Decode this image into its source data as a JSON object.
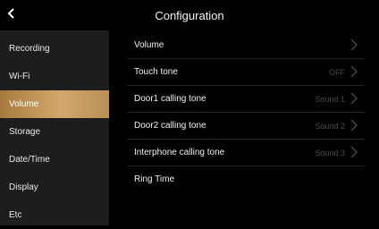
{
  "header": {
    "title": "Configuration",
    "back_icon": "chevron-left-icon"
  },
  "sidebar": {
    "items": [
      {
        "label": "Recording"
      },
      {
        "label": "Wi-Fi"
      },
      {
        "label": "Volume",
        "active": true
      },
      {
        "label": "Storage"
      },
      {
        "label": "Date/Time"
      },
      {
        "label": "Display"
      },
      {
        "label": "Etc"
      }
    ],
    "active_color": "#c89d5f"
  },
  "content": {
    "rows": [
      {
        "label": "Volume",
        "value": ""
      },
      {
        "label": "Touch tone",
        "value": "OFF"
      },
      {
        "label": "Door1 calling tone",
        "value": "Sound 1"
      },
      {
        "label": "Door2 calling tone",
        "value": "Sound 2"
      },
      {
        "label": "Interphone calling tone",
        "value": "Sound 3"
      },
      {
        "label": "Ring Time",
        "value": ""
      }
    ]
  }
}
